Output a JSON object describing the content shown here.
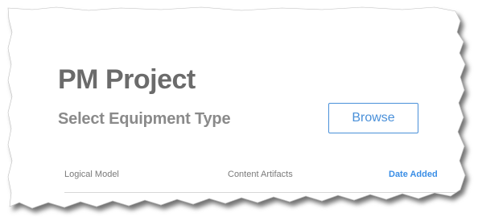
{
  "page": {
    "title": "PM Project",
    "subtitle": "Select Equipment Type",
    "browse_label": "Browse"
  },
  "table": {
    "columns": [
      "Logical Model",
      "Content Artifacts",
      "Date Added"
    ]
  },
  "colors": {
    "accent": "#4a90d9",
    "title_text": "#6b6b6b",
    "subtitle_text": "#8a8a8a",
    "header_text": "#7a7a7a"
  }
}
